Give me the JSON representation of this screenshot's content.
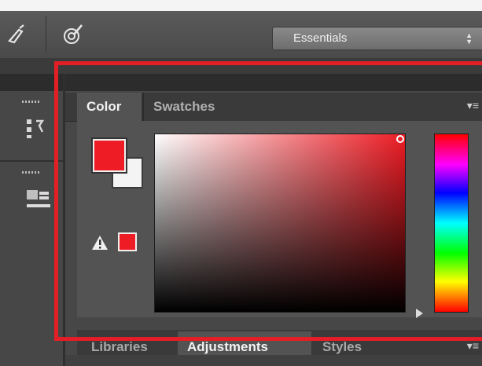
{
  "toolbar": {
    "workspace_label": "Essentials",
    "workspace_arrows": "▴▾"
  },
  "color_panel": {
    "tabs": [
      {
        "label": "Color",
        "active": true
      },
      {
        "label": "Swatches",
        "active": false
      }
    ],
    "menu_icon": "panel-menu-icon",
    "foreground_color": "#ee1c24",
    "background_color": "#f4f4f4",
    "out_of_gamut_icon": "warning-icon",
    "closest_color": "#ee1c24"
  },
  "bottom_panel": {
    "tabs": [
      {
        "label": "Libraries",
        "active": false
      },
      {
        "label": "Adjustments",
        "active": true
      },
      {
        "label": "Styles",
        "active": false
      }
    ]
  },
  "highlight_color": "#e41e26"
}
